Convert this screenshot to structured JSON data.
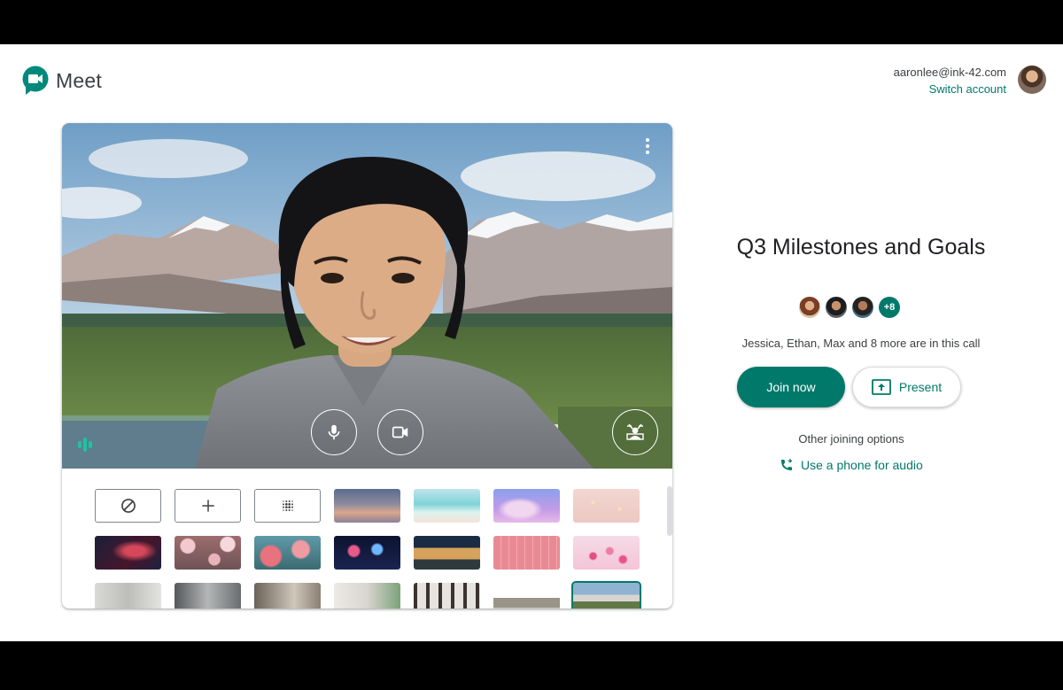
{
  "app": {
    "name": "Meet"
  },
  "account": {
    "email": "aaronlee@ink-42.com",
    "switch_label": "Switch account"
  },
  "meeting": {
    "title": "Q3 Milestones and Goals",
    "extra_participants": "+8",
    "in_call_text": "Jessica, Ethan, Max and 8 more are in this call"
  },
  "actions": {
    "join_label": "Join now",
    "present_label": "Present",
    "other_options_label": "Other joining options",
    "phone_audio_label": "Use a phone for audio"
  },
  "icons": {
    "more": "more-vert-icon",
    "mic": "mic-icon",
    "camera": "videocam-icon",
    "background": "background-replace-icon",
    "no_background": "block-icon",
    "add_background": "add-icon",
    "blur": "blur-icon",
    "present": "present-to-all-icon",
    "phone": "phone-forwarded-icon"
  },
  "colors": {
    "accent": "#00796b",
    "audio_indicator": "#1ec3a0"
  }
}
